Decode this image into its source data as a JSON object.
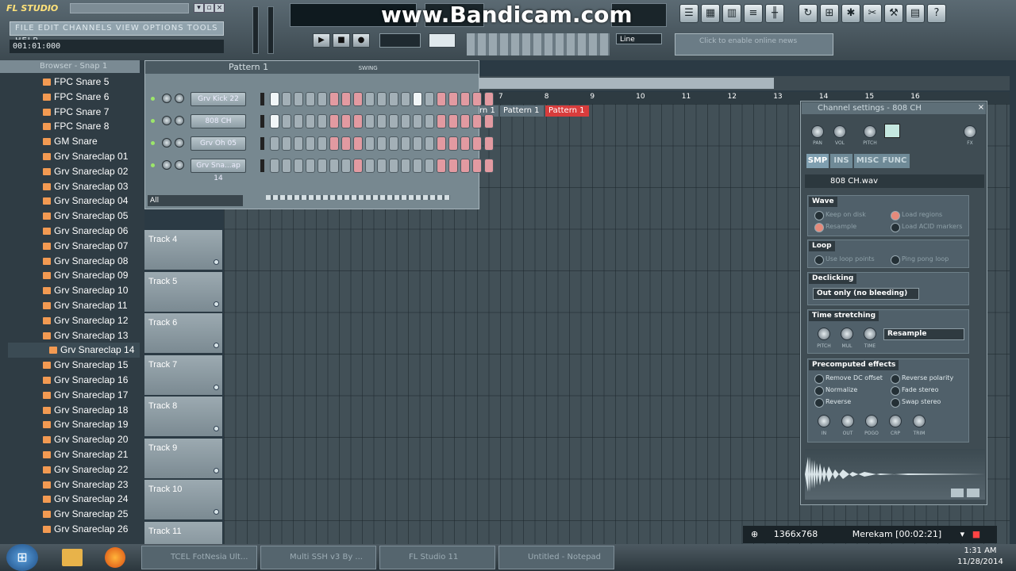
{
  "app": {
    "logo": "FL STUDIO",
    "menu": "FILE EDIT CHANNELS VIEW OPTIONS TOOLS HELP",
    "time": "001:01:000",
    "watermark": "www.Bandicam.com",
    "line_mode": "Line",
    "news": "Click to enable online news"
  },
  "browser": {
    "title": "Browser - Snap 1",
    "items": [
      "FPC Snare 5",
      "FPC Snare 6",
      "FPC Snare 7",
      "FPC Snare 8",
      "GM Snare",
      "Grv Snareclap 01",
      "Grv Snareclap 02",
      "Grv Snareclap 03",
      "Grv Snareclap 04",
      "Grv Snareclap 05",
      "Grv Snareclap 06",
      "Grv Snareclap 07",
      "Grv Snareclap 08",
      "Grv Snareclap 09",
      "Grv Snareclap 10",
      "Grv Snareclap 11",
      "Grv Snareclap 12",
      "Grv Snareclap 13",
      "Grv Snareclap 14",
      "Grv Snareclap 15",
      "Grv Snareclap 16",
      "Grv Snareclap 17",
      "Grv Snareclap 18",
      "Grv Snareclap 19",
      "Grv Snareclap 20",
      "Grv Snareclap 21",
      "Grv Snareclap 22",
      "Grv Snareclap 23",
      "Grv Snareclap 24",
      "Grv Snareclap 25",
      "Grv Snareclap 26"
    ],
    "selected_index": 18
  },
  "step_sequencer": {
    "title": "Pattern 1",
    "swing_label": "SWING",
    "filter": "All",
    "channels": [
      {
        "name": "Grv Kick 22",
        "steps": "wggggrrrggggwgrrrrr"
      },
      {
        "name": "808 CH",
        "steps": "wggggrrrggggggrrrrr"
      },
      {
        "name": "Grv Oh 05",
        "steps": "gggggrrrggggggrrrrr"
      },
      {
        "name": "Grv Sna...ap 14",
        "steps": "gggggggrggggggrrrrr"
      }
    ]
  },
  "playlist": {
    "ruler": [
      "7",
      "8",
      "9",
      "10",
      "11",
      "12",
      "13",
      "14",
      "15",
      "16"
    ],
    "patterns": [
      "rn 1",
      "Pattern 1",
      "Pattern 1"
    ],
    "tracks": [
      "Track 4",
      "Track 5",
      "Track 6",
      "Track 7",
      "Track 8",
      "Track 9",
      "Track 10",
      "Track 11"
    ]
  },
  "channel_settings": {
    "title": "Channel settings - 808 CH",
    "tabs": [
      "SMP",
      "INS",
      "MISC",
      "FUNC"
    ],
    "file": "808 CH.wav",
    "wave": {
      "title": "Wave",
      "opts": [
        "Keep on disk",
        "Resample",
        "Load regions",
        "Load ACID markers"
      ]
    },
    "loop": {
      "title": "Loop",
      "opts": [
        "Use loop points",
        "Ping pong loop"
      ]
    },
    "declicking": {
      "title": "Declicking",
      "mode": "Out only (no bleeding)"
    },
    "time_stretching": {
      "title": "Time stretching",
      "mode": "Resample",
      "knobs": [
        "PITCH",
        "MUL",
        "TIME"
      ]
    },
    "precomputed": {
      "title": "Precomputed effects",
      "left": [
        "Remove DC offset",
        "Normalize",
        "Reverse"
      ],
      "right": [
        "Reverse polarity",
        "Fade stereo",
        "Swap stereo"
      ],
      "knobs": [
        "IN",
        "OUT",
        "POGO",
        "CRP",
        "TRIM"
      ]
    },
    "top_knobs": [
      "PAN",
      "VOL",
      "PITCH",
      "FX"
    ]
  },
  "recorder": {
    "resolution": "1366x768",
    "status": "Merekam [00:02:21]"
  },
  "taskbar": {
    "items": [
      "TCEL FotNesia Ult...",
      "Multi SSH v3 By ...",
      "FL Studio 11",
      "Untitled - Notepad"
    ],
    "time": "1:31 AM",
    "date": "11/28/2014"
  }
}
